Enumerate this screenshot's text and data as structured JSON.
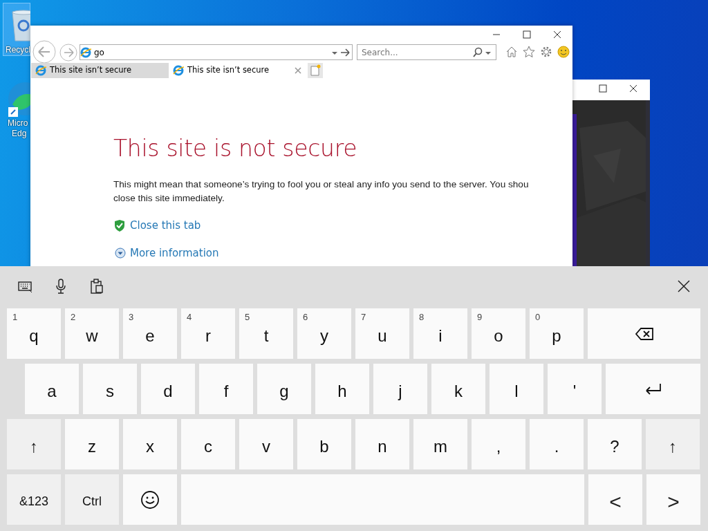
{
  "desktop": {
    "icons": [
      {
        "kind": "recycle",
        "lines": [
          "Recycl"
        ],
        "selected": true
      },
      {
        "kind": "edge",
        "lines": [
          "Micro",
          "Edg"
        ],
        "selected": false
      }
    ]
  },
  "browser": {
    "address": "go",
    "search": {
      "placeholder": "Search..."
    },
    "tabs": [
      {
        "title": "This site isn’t secure",
        "selected": false
      },
      {
        "title": "This site isn’t secure",
        "selected": true
      }
    ],
    "page": {
      "heading": "This site is not secure",
      "lines": [
        "This might mean that someone’s trying to fool you or steal any info you send to the server. You shou",
        "close this site immediately."
      ],
      "links": [
        {
          "kind": "shield",
          "label": "Close this tab"
        },
        {
          "kind": "expand",
          "label": "More information"
        }
      ]
    }
  },
  "keyboard": {
    "rows": [
      {
        "keys": [
          {
            "label": "q",
            "hint": "1"
          },
          {
            "label": "w",
            "hint": "2"
          },
          {
            "label": "e",
            "hint": "3"
          },
          {
            "label": "r",
            "hint": "4"
          },
          {
            "label": "t",
            "hint": "5"
          },
          {
            "label": "y",
            "hint": "6"
          },
          {
            "label": "u",
            "hint": "7"
          },
          {
            "label": "i",
            "hint": "8"
          },
          {
            "label": "o",
            "hint": "9"
          },
          {
            "label": "p",
            "hint": "0"
          },
          {
            "kind": "backspace"
          }
        ]
      },
      {
        "keys": [
          {
            "label": "a"
          },
          {
            "label": "s"
          },
          {
            "label": "d"
          },
          {
            "label": "f"
          },
          {
            "label": "g"
          },
          {
            "label": "h"
          },
          {
            "label": "j"
          },
          {
            "label": "k"
          },
          {
            "label": "l"
          },
          {
            "label": "'"
          },
          {
            "kind": "enter"
          }
        ]
      },
      {
        "keys": [
          {
            "kind": "shift",
            "label": "↑"
          },
          {
            "label": "z"
          },
          {
            "label": "x"
          },
          {
            "label": "c"
          },
          {
            "label": "v"
          },
          {
            "label": "b"
          },
          {
            "label": "n"
          },
          {
            "label": "m"
          },
          {
            "label": ","
          },
          {
            "label": "."
          },
          {
            "label": "?"
          },
          {
            "kind": "shift",
            "label": "↑"
          }
        ]
      },
      {
        "keys": [
          {
            "kind": "mode",
            "label": "&123"
          },
          {
            "kind": "mode",
            "label": "Ctrl"
          },
          {
            "kind": "emoji"
          },
          {
            "kind": "space"
          },
          {
            "kind": "arrow",
            "label": "<"
          },
          {
            "kind": "arrow",
            "label": ">"
          }
        ]
      }
    ]
  }
}
